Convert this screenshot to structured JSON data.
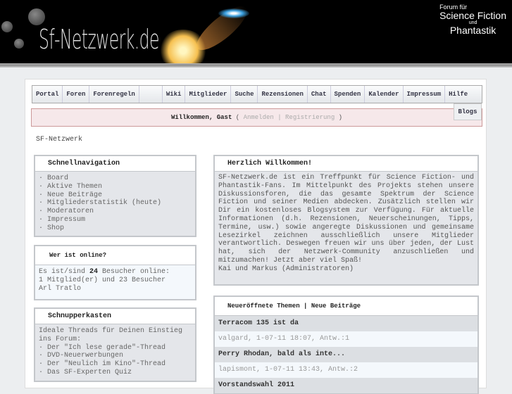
{
  "header": {
    "logo": "Sf-Netzwerk.de",
    "tagline_small": "Forum für",
    "tagline_main": "Science Fiction",
    "tagline_und": "und",
    "tagline_sub": "Phantastik"
  },
  "nav": [
    "Portal",
    "Foren",
    "Forenregeln",
    "Wiki",
    "Mitglieder",
    "Suche",
    "Rezensionen",
    "Chat",
    "Spenden",
    "Kalender",
    "Impressum",
    "Hilfe"
  ],
  "nav_extra": "Blogs",
  "welcome": {
    "greeting": "Willkommen, Gast",
    "open": "(",
    "login": "Anmelden",
    "sep": "|",
    "register": "Registrierung",
    "close": ")"
  },
  "breadcrumb": "SF-Netzwerk",
  "quicknav": {
    "title": "Schnellnavigation",
    "items": [
      "· Board",
      "· Aktive Themen",
      "· Neue Beiträge",
      "· Mitgliederstatistik (heute)",
      "· Moderatoren",
      "· Impressum",
      "· Shop"
    ]
  },
  "online": {
    "title": "Wer ist online?",
    "pre": "Es ist/sind ",
    "count": "24",
    "post": " Besucher online:",
    "line2": "1 Mitglied(er) und 23 Besucher",
    "member": "Arl Tratlo"
  },
  "teaser": {
    "title": "Schnupperkasten",
    "intro": "Ideale Threads für Deinen Einstieg ins Forum:",
    "items": [
      "· Der \"Ich lese gerade\"-Thread",
      "· DVD-Neuerwerbungen",
      "· Der \"Neulich im Kino\"-Thread",
      "· Das SF-Experten Quiz"
    ]
  },
  "intro": {
    "title": "Herzlich Willkommen!",
    "text": "SF-Netzwerk.de ist ein Treffpunkt für Science Fiction- und Phantastik-Fans. Im Mittelpunkt des Projekts stehen unsere Diskussionsforen, die das gesamte Spektrum der Science Fiction und seiner Medien abdecken. Zusätzlich stellen wir Dir ein kostenloses Blogsystem zur Verfügung. Für aktuelle Informationen (d.h. Rezensionen, Neuerscheinungen, Tipps, Termine, usw.) sowie angeregte Diskussionen und gemeinsame Lesezirkel zeichnen ausschließlich unsere Mitglieder verantwortlich. Deswegen freuen wir uns über jeden, der Lust hat, sich der Netzwerk-Community anzuschließen und mitzumachen! Jetzt aber viel Spaß!",
    "sign": "Kai und Markus (Administratoren)"
  },
  "recent": {
    "tab1": "Neueröffnete Themen",
    "sep": " | ",
    "tab2": "Neue Beiträge",
    "threads": [
      {
        "title": "Terracom 135 ist da",
        "meta": "valgard, 1-07-11 18:07, Antw.:1"
      },
      {
        "title": "Perry Rhodan, bald als inte...",
        "meta": "lapismont, 1-07-11 13:43, Antw.:2"
      },
      {
        "title": "Vorstandswahl 2011",
        "meta": ""
      }
    ]
  }
}
